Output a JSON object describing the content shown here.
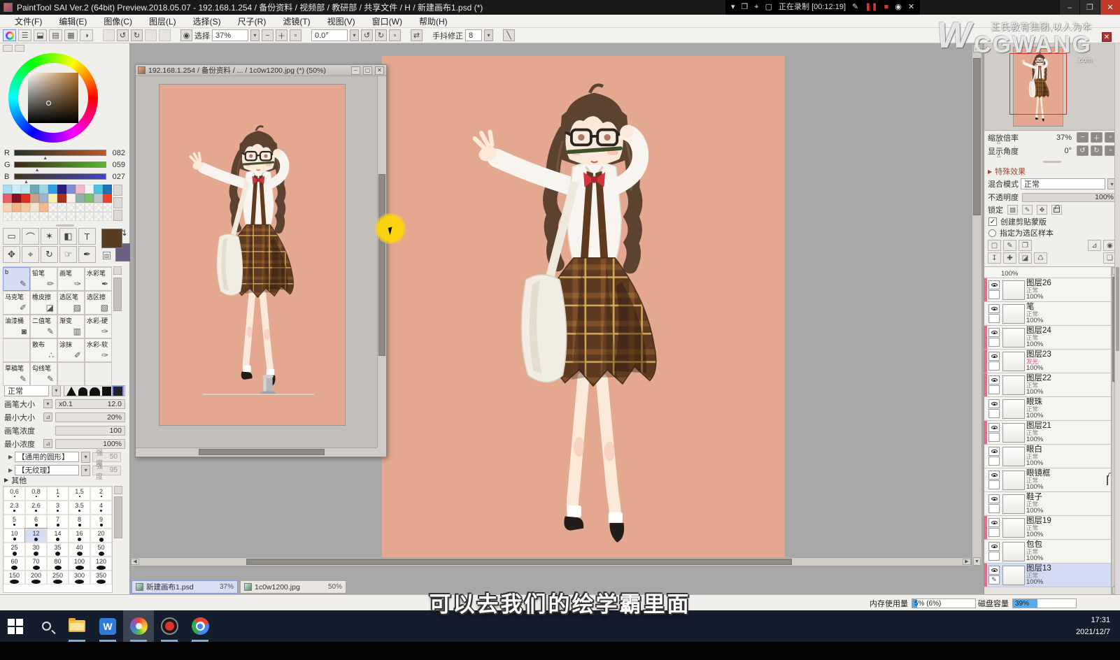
{
  "app": {
    "title": "PaintTool SAI Ver.2 (64bit) Preview.2018.05.07 - 192.168.1.254 / 备份资料 / 视频部 / 教研部 / 共享文件 / H / 新建画布1.psd (*)"
  },
  "recorder": {
    "status_text": "正在录制 [00:12:19]"
  },
  "menu": {
    "items": [
      "文件(F)",
      "编辑(E)",
      "图像(C)",
      "图层(L)",
      "选择(S)",
      "尺子(R)",
      "滤镜(T)",
      "视图(V)",
      "窗口(W)",
      "帮助(H)"
    ]
  },
  "toolbar": {
    "select_label": "选择",
    "zoom_value": "37%",
    "angle_value": "0.0°",
    "stab_label": "手抖修正",
    "stab_value": "8"
  },
  "color_panel": {
    "r_label": "R",
    "g_label": "G",
    "b_label": "B",
    "r_value": "082",
    "g_value": "059",
    "b_value": "027",
    "swatches": [
      "#a8def0",
      "#cdeef6",
      "#bfe9ef",
      "#6fa9b5",
      "#9ed5e6",
      "#2f9fe8",
      "#2a1e7e",
      "#7e8ed0",
      "#f2b9cf",
      "#edf4f4",
      "#4fc3de",
      "#1f72b5",
      "#e85f6e",
      "#7f1621",
      "#e02f22",
      "#c9a089",
      "#9eb3c8",
      "#f7f0a8",
      "#a83218",
      "#f2f2ea",
      "#8fb3a7",
      "#7fbf70",
      "#bfc4c8",
      "#ef3f2f",
      "#f7d4b3",
      "#efb489",
      "#f2c9a0",
      "#efe3d3",
      "#f2b98f",
      "",
      "",
      "",
      "",
      "",
      "",
      "",
      "",
      "",
      "",
      "",
      "",
      "",
      "",
      "",
      "",
      "",
      "",
      ""
    ]
  },
  "tools": {
    "row1": [
      {
        "name": "rect-select",
        "glyph": "▭"
      },
      {
        "name": "lasso",
        "glyph": "⌒"
      },
      {
        "name": "magic-wand",
        "glyph": "✶"
      },
      {
        "name": "shape-select",
        "glyph": "◧"
      },
      {
        "name": "text",
        "glyph": "T"
      }
    ],
    "row2": [
      {
        "name": "move",
        "glyph": "✥"
      },
      {
        "name": "zoom",
        "glyph": "⌖"
      },
      {
        "name": "rotate-view",
        "glyph": "↻"
      },
      {
        "name": "hand",
        "glyph": "☞"
      },
      {
        "name": "eyedropper",
        "glyph": "✒"
      }
    ],
    "fg_color": "#5a3c21",
    "bg_color": "#6e5f85"
  },
  "brushes": {
    "items": [
      {
        "label": "b",
        "glyph": "✎",
        "selected": true
      },
      {
        "label": "铅笔",
        "glyph": "✏",
        "selected": false
      },
      {
        "label": "画笔",
        "glyph": "✑",
        "selected": false
      },
      {
        "label": "水彩笔",
        "glyph": "✒",
        "selected": false
      },
      {
        "label": "马克笔",
        "glyph": "✐",
        "selected": false
      },
      {
        "label": "橡皮擦",
        "glyph": "◪",
        "selected": false
      },
      {
        "label": "选区笔",
        "glyph": "▨",
        "selected": false
      },
      {
        "label": "选区擦",
        "glyph": "▧",
        "selected": false
      },
      {
        "label": "油漆桶",
        "glyph": "◙",
        "selected": false
      },
      {
        "label": "二值笔",
        "glyph": "✎",
        "selected": false
      },
      {
        "label": "渐变",
        "glyph": "▥",
        "selected": false
      },
      {
        "label": "水彩-硬",
        "glyph": "✑",
        "selected": false
      },
      {
        "label": "",
        "glyph": "",
        "selected": false
      },
      {
        "label": "散布",
        "glyph": "∴",
        "selected": false
      },
      {
        "label": "涂抹",
        "glyph": "✐",
        "selected": false
      },
      {
        "label": "水彩-软",
        "glyph": "✑",
        "selected": false
      },
      {
        "label": "草稿笔",
        "glyph": "✎",
        "selected": false
      },
      {
        "label": "勾线笔",
        "glyph": "✎",
        "selected": false
      },
      {
        "label": "",
        "glyph": "",
        "selected": false
      },
      {
        "label": "",
        "glyph": "",
        "selected": false
      }
    ]
  },
  "brush_settings": {
    "mode_value": "正常",
    "size_label": "画笔大小",
    "size_mult": "x0.1",
    "size_value": "12.0",
    "min_size_label": "最小大小",
    "min_size_value": "20%",
    "density_label": "画笔浓度",
    "density_value": "100",
    "min_density_label": "最小浓度",
    "min_density_value": "100%",
    "shape_preset": "【通用的圆形】",
    "shape_strength_label": "强度",
    "shape_strength": "50",
    "texture_preset": "【无纹理】",
    "texture_strength_label": "强度",
    "texture_strength": "95",
    "others_label": "其他"
  },
  "size_presets": {
    "values": [
      "0.6",
      "0.8",
      "1",
      "1.5",
      "2",
      "2.3",
      "2.6",
      "3",
      "3.5",
      "4",
      "5",
      "6",
      "7",
      "8",
      "9",
      "10",
      "12",
      "14",
      "16",
      "20",
      "25",
      "30",
      "35",
      "40",
      "50",
      "60",
      "70",
      "80",
      "100",
      "120",
      "150",
      "200",
      "250",
      "300",
      "350"
    ],
    "selected": "12"
  },
  "float_window": {
    "title": "192.168.1.254 / 备份资料 / ... / 1c0w1200.jpg (*) (50%)"
  },
  "layer_panel": {
    "zoom_label": "缩放倍率",
    "zoom_value": "37%",
    "angle_label": "显示角度",
    "angle_value": "0°",
    "effects_label": "特殊效果",
    "blend_label": "混合模式",
    "blend_value": "正常",
    "opacity_label": "不透明度",
    "opacity_value": "100%",
    "lock_label": "锁定",
    "clip_label": "创建剪贴蒙版",
    "selsample_label": "指定为选区样本",
    "layers": [
      {
        "name": "",
        "mode": "",
        "opacity": "100%",
        "clip": true,
        "partial": true,
        "selected": false,
        "locked": false,
        "mode_special": false
      },
      {
        "name": "图层26",
        "mode": "正常",
        "opacity": "100%",
        "clip": true,
        "partial": false,
        "selected": false,
        "locked": false,
        "mode_special": false
      },
      {
        "name": "笔",
        "mode": "正常",
        "opacity": "100%",
        "clip": false,
        "partial": false,
        "selected": false,
        "locked": false,
        "mode_special": false
      },
      {
        "name": "图层24",
        "mode": "正常",
        "opacity": "100%",
        "clip": true,
        "partial": false,
        "selected": false,
        "locked": false,
        "mode_special": false
      },
      {
        "name": "图层23",
        "mode": "发光",
        "opacity": "100%",
        "clip": true,
        "partial": false,
        "selected": false,
        "locked": false,
        "mode_special": true
      },
      {
        "name": "图层22",
        "mode": "正常",
        "opacity": "100%",
        "clip": true,
        "partial": false,
        "selected": false,
        "locked": false,
        "mode_special": false
      },
      {
        "name": "眼珠",
        "mode": "正常",
        "opacity": "100%",
        "clip": false,
        "partial": false,
        "selected": false,
        "locked": false,
        "mode_special": false
      },
      {
        "name": "图层21",
        "mode": "正常",
        "opacity": "100%",
        "clip": true,
        "partial": false,
        "selected": false,
        "locked": false,
        "mode_special": false
      },
      {
        "name": "眼白",
        "mode": "正常",
        "opacity": "100%",
        "clip": false,
        "partial": false,
        "selected": false,
        "locked": false,
        "mode_special": false
      },
      {
        "name": "眼镜框",
        "mode": "正常",
        "opacity": "100%",
        "clip": false,
        "partial": false,
        "selected": false,
        "locked": true,
        "mode_special": false
      },
      {
        "name": "鞋子",
        "mode": "正常",
        "opacity": "100%",
        "clip": false,
        "partial": false,
        "selected": false,
        "locked": false,
        "mode_special": false
      },
      {
        "name": "图层19",
        "mode": "正常",
        "opacity": "100%",
        "clip": true,
        "partial": false,
        "selected": false,
        "locked": false,
        "mode_special": false
      },
      {
        "name": "包包",
        "mode": "正常",
        "opacity": "100%",
        "clip": false,
        "partial": false,
        "selected": false,
        "locked": false,
        "mode_special": false
      },
      {
        "name": "图层13",
        "mode": "正常",
        "opacity": "100%",
        "clip": true,
        "partial": false,
        "selected": true,
        "locked": false,
        "mode_special": false
      }
    ]
  },
  "doc_tabs": [
    {
      "name": "新建画布1.psd",
      "zoom": "37%",
      "active": true
    },
    {
      "name": "1c0w1200.jpg",
      "zoom": "50%",
      "active": false
    }
  ],
  "subtitle": {
    "text": "可以去我们的绘学霸里面"
  },
  "status": {
    "memory_label": "内存使用量",
    "memory_value": "5% (6%)",
    "memory_fill": 8,
    "disk_label": "磁盘容量",
    "disk_value": "39%",
    "disk_fill": 39
  },
  "taskbar": {
    "items": [
      "start",
      "search",
      "explorer",
      "wps",
      "sai",
      "recorder",
      "chrome"
    ],
    "time": "17:31",
    "date": "2021/12/7"
  },
  "watermark": {
    "company": "王氏教育集团,以人为本",
    "brand": "CGWANG",
    "brand_suffix": ".com",
    "w_glyph": "W"
  }
}
